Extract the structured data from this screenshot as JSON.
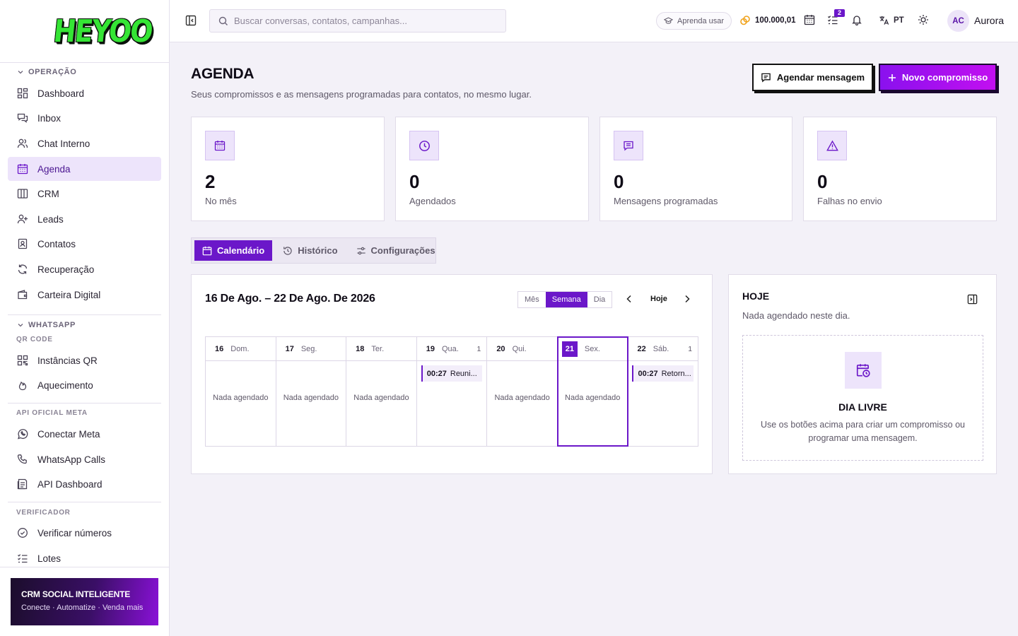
{
  "app": {
    "logo_text": "HEYOO",
    "accent_color": "#6b17c9",
    "logo_color": "#35e535"
  },
  "sidebar": {
    "section_operacao": "OPERAÇÃO",
    "items_operacao": [
      {
        "label": "Dashboard",
        "icon": "dashboard-icon"
      },
      {
        "label": "Inbox",
        "icon": "inbox-icon"
      },
      {
        "label": "Chat Interno",
        "icon": "users-icon"
      },
      {
        "label": "Agenda",
        "icon": "calendar-icon",
        "active": true
      },
      {
        "label": "CRM",
        "icon": "columns-icon"
      },
      {
        "label": "Leads",
        "icon": "user-plus-icon"
      },
      {
        "label": "Contatos",
        "icon": "contact-book-icon"
      },
      {
        "label": "Recuperação",
        "icon": "refresh-icon"
      },
      {
        "label": "Carteira Digital",
        "icon": "wallet-icon"
      }
    ],
    "section_whatsapp": "WHATSAPP",
    "sub_qr": "QR CODE",
    "items_qr": [
      {
        "label": "Instâncias QR",
        "icon": "qr-code-icon"
      },
      {
        "label": "Aquecimento",
        "icon": "flame-icon"
      }
    ],
    "sub_api": "API OFICIAL META",
    "items_api": [
      {
        "label": "Conectar Meta",
        "icon": "whatsapp-icon"
      },
      {
        "label": "WhatsApp Calls",
        "icon": "phone-icon"
      },
      {
        "label": "API Dashboard",
        "icon": "api-dashboard-icon"
      }
    ],
    "sub_verificador": "VERIFICADOR",
    "items_verificador": [
      {
        "label": "Verificar números",
        "icon": "check-circle-icon"
      },
      {
        "label": "Lotes",
        "icon": "list-check-icon"
      }
    ],
    "promo": {
      "title": "CRM SOCIAL INTELIGENTE",
      "subtitle": "Conecte · Automatize · Venda mais"
    }
  },
  "header": {
    "search_placeholder": "Buscar conversas, contatos, campanhas...",
    "learn_label": "Aprenda usar",
    "coins": "100.000,01",
    "tasks_badge": "2",
    "language": "PT",
    "avatar_initials": "AC",
    "user_name": "Aurora"
  },
  "page": {
    "title": "AGENDA",
    "subtitle": "Seus compromissos e as mensagens programadas para contatos, no mesmo lugar.",
    "btn_schedule": "Agendar mensagem",
    "btn_new": "Novo compromisso"
  },
  "stats": [
    {
      "value": "2",
      "label": "No mês",
      "icon": "calendar-icon"
    },
    {
      "value": "0",
      "label": "Agendados",
      "icon": "clock-icon"
    },
    {
      "value": "0",
      "label": "Mensagens programadas",
      "icon": "message-icon"
    },
    {
      "value": "0",
      "label": "Falhas no envio",
      "icon": "warning-icon"
    }
  ],
  "tabs": [
    {
      "label": "Calendário",
      "icon": "calendar-icon",
      "active": true
    },
    {
      "label": "Histórico",
      "icon": "history-icon"
    },
    {
      "label": "Configurações",
      "icon": "settings-sliders-icon"
    }
  ],
  "calendar": {
    "range": "16 De Ago. – 22 De Ago. De 2026",
    "views": [
      "Mês",
      "Semana",
      "Dia"
    ],
    "active_view": "Semana",
    "today_label": "Hoje",
    "empty_text": "Nada agendado",
    "days": [
      {
        "num": "16",
        "name": "Dom.",
        "count": "",
        "event": null
      },
      {
        "num": "17",
        "name": "Seg.",
        "count": "",
        "event": null
      },
      {
        "num": "18",
        "name": "Ter.",
        "count": "",
        "event": null
      },
      {
        "num": "19",
        "name": "Qua.",
        "count": "1",
        "event": {
          "time": "00:27",
          "title": "Reuni..."
        }
      },
      {
        "num": "20",
        "name": "Qui.",
        "count": "",
        "event": null
      },
      {
        "num": "21",
        "name": "Sex.",
        "count": "",
        "event": null,
        "today": true
      },
      {
        "num": "22",
        "name": "Sáb.",
        "count": "1",
        "event": {
          "time": "00:27",
          "title": "Retorn..."
        }
      }
    ]
  },
  "today_panel": {
    "title": "HOJE",
    "subtitle": "Nada agendado neste dia.",
    "free_title": "DIA LIVRE",
    "free_text": "Use os botões acima para criar um compromisso ou programar uma mensagem."
  }
}
